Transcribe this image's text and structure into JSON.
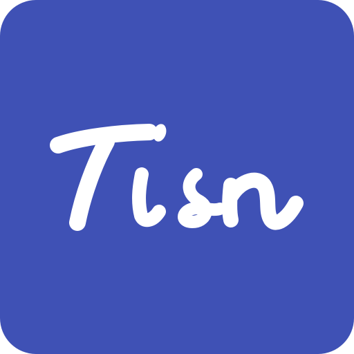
{
  "app_icon": {
    "background_color": "#3f51b5",
    "foreground_color": "#ffffff",
    "logo_text": "Tisn",
    "icon_name": "tisn-logo-icon"
  }
}
